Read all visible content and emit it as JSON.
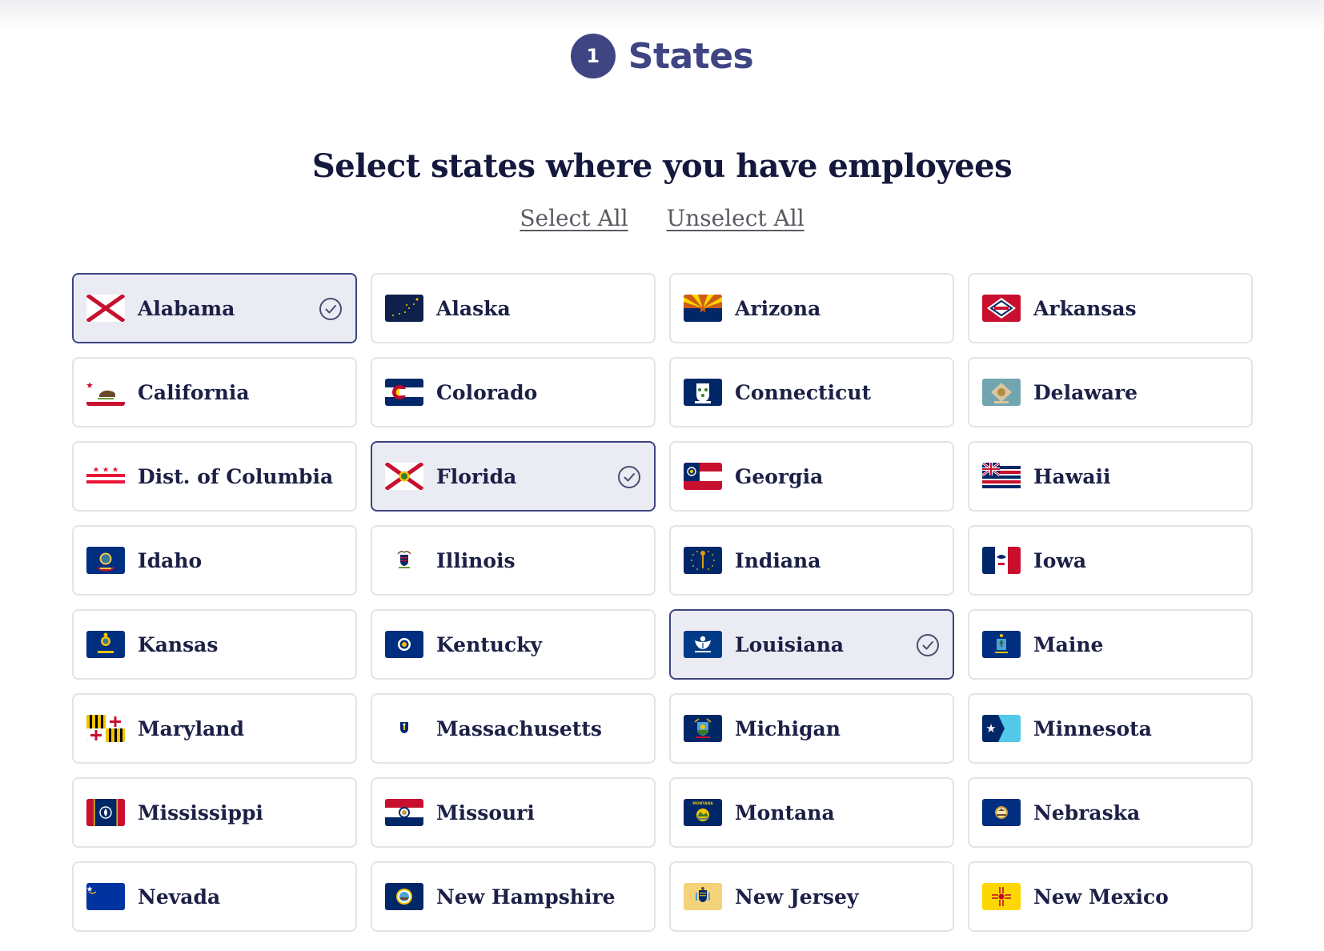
{
  "step": {
    "number": "1",
    "title": "States"
  },
  "question": "Select states where you have employees",
  "actions": {
    "select_all": "Select All",
    "unselect_all": "Unselect All"
  },
  "states": [
    {
      "label": "Alabama",
      "flag": "alabama-flag",
      "selected": true
    },
    {
      "label": "Alaska",
      "flag": "alaska-flag",
      "selected": false
    },
    {
      "label": "Arizona",
      "flag": "arizona-flag",
      "selected": false
    },
    {
      "label": "Arkansas",
      "flag": "arkansas-flag",
      "selected": false
    },
    {
      "label": "California",
      "flag": "california-flag",
      "selected": false
    },
    {
      "label": "Colorado",
      "flag": "colorado-flag",
      "selected": false
    },
    {
      "label": "Connecticut",
      "flag": "connecticut-flag",
      "selected": false
    },
    {
      "label": "Delaware",
      "flag": "delaware-flag",
      "selected": false
    },
    {
      "label": "Dist. of Columbia",
      "flag": "dc-flag",
      "selected": false
    },
    {
      "label": "Florida",
      "flag": "florida-flag",
      "selected": true
    },
    {
      "label": "Georgia",
      "flag": "georgia-flag",
      "selected": false
    },
    {
      "label": "Hawaii",
      "flag": "hawaii-flag",
      "selected": false
    },
    {
      "label": "Idaho",
      "flag": "idaho-flag",
      "selected": false
    },
    {
      "label": "Illinois",
      "flag": "illinois-flag",
      "selected": false
    },
    {
      "label": "Indiana",
      "flag": "indiana-flag",
      "selected": false
    },
    {
      "label": "Iowa",
      "flag": "iowa-flag",
      "selected": false
    },
    {
      "label": "Kansas",
      "flag": "kansas-flag",
      "selected": false
    },
    {
      "label": "Kentucky",
      "flag": "kentucky-flag",
      "selected": false
    },
    {
      "label": "Louisiana",
      "flag": "louisiana-flag",
      "selected": true
    },
    {
      "label": "Maine",
      "flag": "maine-flag",
      "selected": false
    },
    {
      "label": "Maryland",
      "flag": "maryland-flag",
      "selected": false
    },
    {
      "label": "Massachusetts",
      "flag": "massachusetts-flag",
      "selected": false
    },
    {
      "label": "Michigan",
      "flag": "michigan-flag",
      "selected": false
    },
    {
      "label": "Minnesota",
      "flag": "minnesota-flag",
      "selected": false
    },
    {
      "label": "Mississippi",
      "flag": "mississippi-flag",
      "selected": false
    },
    {
      "label": "Missouri",
      "flag": "missouri-flag",
      "selected": false
    },
    {
      "label": "Montana",
      "flag": "montana-flag",
      "selected": false
    },
    {
      "label": "Nebraska",
      "flag": "nebraska-flag",
      "selected": false
    },
    {
      "label": "Nevada",
      "flag": "nevada-flag",
      "selected": false
    },
    {
      "label": "New Hampshire",
      "flag": "new-hampshire-flag",
      "selected": false
    },
    {
      "label": "New Jersey",
      "flag": "new-jersey-flag",
      "selected": false
    },
    {
      "label": "New Mexico",
      "flag": "new-mexico-flag",
      "selected": false
    }
  ],
  "colors": {
    "accent": "#3f4582",
    "selected_bg": "#ebebf3",
    "card_border": "#e3e3e8",
    "text": "#1c2046"
  }
}
